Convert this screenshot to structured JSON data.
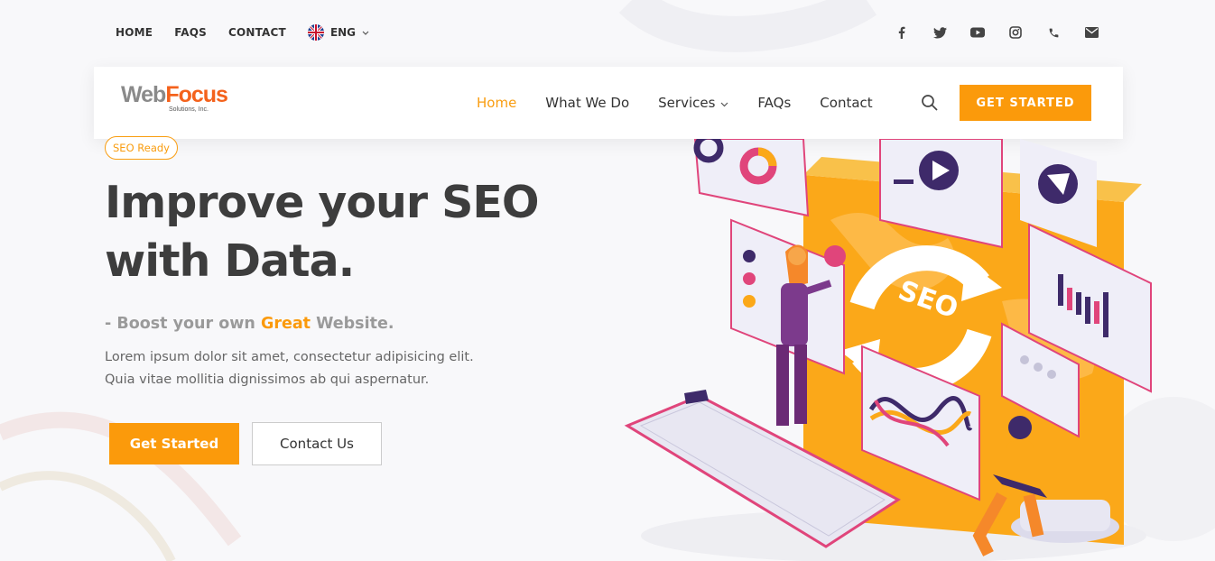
{
  "topbar": {
    "links": [
      "HOME",
      "FAQS",
      "CONTACT"
    ],
    "language": "ENG"
  },
  "socials": [
    "facebook-icon",
    "twitter-icon",
    "youtube-icon",
    "instagram-icon",
    "phone-icon",
    "mail-icon"
  ],
  "logo": {
    "web": "Web",
    "focus": "Focus",
    "sub": "Solutions, Inc."
  },
  "nav": {
    "items": [
      "Home",
      "What We Do",
      "Services",
      "FAQs",
      "Contact"
    ],
    "active": "Home",
    "cta": "GET STARTED"
  },
  "hero": {
    "badge": "SEO Ready",
    "headline_line1": "Improve your SEO",
    "headline_line2": "with Data.",
    "tagline_pre": "- Boost your own ",
    "tagline_highlight": "Great",
    "tagline_post": " Website.",
    "desc_line1": "Lorem ipsum dolor sit amet, consectetur adipisicing elit.",
    "desc_line2": "Quia vitae mollitia dignissimos ab qui aspernatur.",
    "primary_button": "Get Started",
    "secondary_button": "Contact Us"
  },
  "illustration": {
    "label": "SEO"
  },
  "colors": {
    "accent": "#fb9a0b",
    "text": "#3d3d3d",
    "purple": "#3e2a6a",
    "pink": "#e0457b"
  }
}
